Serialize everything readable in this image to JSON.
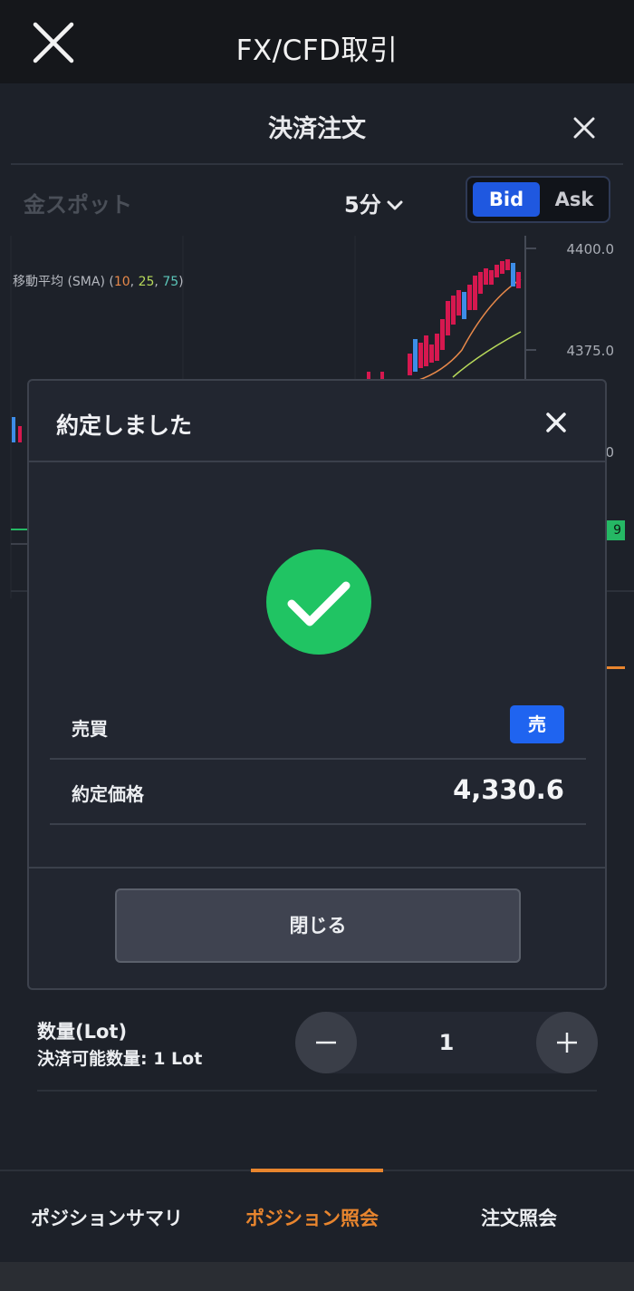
{
  "appbar": {
    "title": "FX/CFD取引"
  },
  "sheet": {
    "title": "決済注文",
    "instrument": "金スポット",
    "interval": "5分",
    "bid_label": "Bid",
    "ask_label": "Ask",
    "selected_side": "Bid"
  },
  "chart": {
    "sma_prefix": "移動平均 (SMA) (",
    "sma_periods": [
      "10",
      "25",
      "75"
    ],
    "sma_suffix": ")",
    "sma_colors": [
      "#e8894a",
      "#b7d95a",
      "#5cc6b9"
    ],
    "axis_labels": [
      "4400.0",
      "4375.0",
      "0"
    ],
    "price_tag": "9",
    "up_color": "#d6184f",
    "down_color": "#3d8de8"
  },
  "quantity": {
    "label": "数量(Lot)",
    "available": "決済可能数量: 1 Lot",
    "value": "1"
  },
  "tabs": [
    {
      "label": "ポジションサマリ",
      "active": false
    },
    {
      "label": "ポジション照会",
      "active": true
    },
    {
      "label": "注文照会",
      "active": false
    }
  ],
  "modal": {
    "title": "約定しました",
    "side_label": "売買",
    "side_value": "売",
    "price_label": "約定価格",
    "price_value": "4,330.6",
    "close_label": "閉じる",
    "success_color": "#20c463"
  }
}
